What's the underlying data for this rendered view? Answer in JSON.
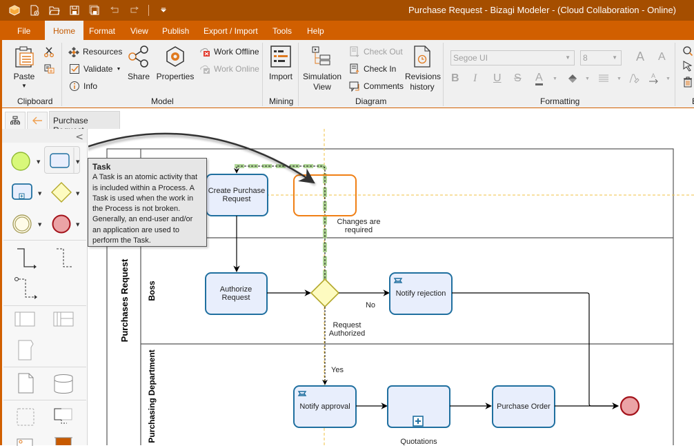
{
  "window": {
    "title": "Purchase Request - Bizagi Modeler - (Cloud Collaboration - Online)"
  },
  "quick_access": [
    "app-logo",
    "new-icon",
    "open-icon",
    "save-icon",
    "save-as-icon",
    "undo-icon",
    "redo-icon",
    "customize-icon"
  ],
  "menu": {
    "items": [
      "File",
      "Home",
      "Format",
      "View",
      "Publish",
      "Export / Import",
      "Tools",
      "Help"
    ],
    "active": "Home"
  },
  "ribbon": {
    "clipboard": {
      "label": "Clipboard",
      "paste": "Paste"
    },
    "model": {
      "label": "Model",
      "resources": "Resources",
      "validate": "Validate",
      "info": "Info",
      "share": "Share",
      "properties": "Properties",
      "work_offline": "Work Offline",
      "work_online": "Work Online"
    },
    "mining": {
      "label": "Mining",
      "import": "Import"
    },
    "diagram": {
      "label": "Diagram",
      "simulation_1": "Simulation",
      "simulation_2": "View",
      "check_out": "Check Out",
      "check_in": "Check In",
      "comments": "Comments",
      "revisions_1": "Revisions",
      "revisions_2": "history"
    },
    "formatting": {
      "label": "Formatting",
      "font": "Segoe UI",
      "size": "8"
    },
    "editing": {
      "label": "E"
    }
  },
  "tabs": {
    "document": "Purchase Request"
  },
  "tooltip": {
    "title": "Task",
    "lines": [
      "A Task is an atomic activity that",
      "is included within a Process. A",
      "Task is used when the work in",
      "the Process is not broken.",
      "Generally, an end-user and/or",
      "an application are used to",
      "perform the Task."
    ]
  },
  "diagram": {
    "pool": "Purchases Request",
    "lanes": [
      "Boss",
      "Purchasing Department"
    ],
    "tasks": {
      "create": [
        "Create Purchase",
        "Request"
      ],
      "authorize": [
        "Authorize",
        "Request"
      ],
      "notify_rejection": "Notify rejection",
      "notify_approval": "Notify approval",
      "purchase_order": "Purchase Order"
    },
    "subprocess_label": "Quotations",
    "gateway_label": [
      "Request",
      "Authorized"
    ],
    "flow_labels": {
      "no": "No",
      "yes": "Yes",
      "changes": [
        "Changes are",
        "required"
      ]
    },
    "colors": {
      "task_fill": "#e8eefc",
      "task_stroke": "#1f6f9f",
      "gateway_fill": "#fdfbc0",
      "gateway_stroke": "#b3a82a",
      "end_fill": "#eba3a6",
      "end_stroke": "#a3121a",
      "drop_target": "#f07f14",
      "guide": "#f2c240",
      "drag_path": "#a9d18e"
    }
  }
}
